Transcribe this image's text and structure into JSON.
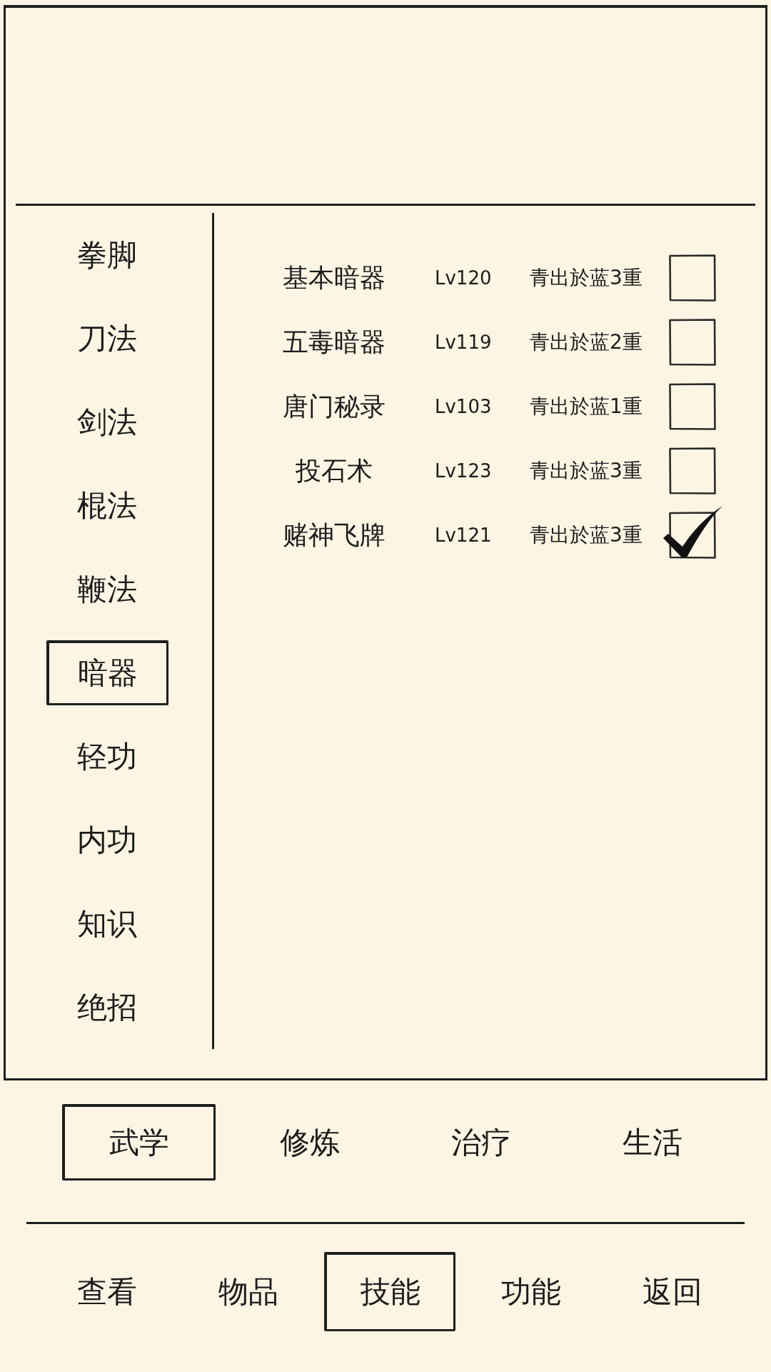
{
  "categories": [
    {
      "label": "拳脚",
      "selected": false
    },
    {
      "label": "刀法",
      "selected": false
    },
    {
      "label": "剑法",
      "selected": false
    },
    {
      "label": "棍法",
      "selected": false
    },
    {
      "label": "鞭法",
      "selected": false
    },
    {
      "label": "暗器",
      "selected": true
    },
    {
      "label": "轻功",
      "selected": false
    },
    {
      "label": "内功",
      "selected": false
    },
    {
      "label": "知识",
      "selected": false
    },
    {
      "label": "绝招",
      "selected": false
    }
  ],
  "skills": [
    {
      "name": "基本暗器",
      "level_label": "Lv120",
      "realm": "青出於蓝3重",
      "checked": false
    },
    {
      "name": "五毒暗器",
      "level_label": "Lv119",
      "realm": "青出於蓝2重",
      "checked": false
    },
    {
      "name": "唐门秘录",
      "level_label": "Lv103",
      "realm": "青出於蓝1重",
      "checked": false
    },
    {
      "name": "投石术",
      "level_label": "Lv123",
      "realm": "青出於蓝3重",
      "checked": false
    },
    {
      "name": "赌神飞牌",
      "level_label": "Lv121",
      "realm": "青出於蓝3重",
      "checked": true
    }
  ],
  "skill_types": [
    {
      "label": "武学",
      "selected": true
    },
    {
      "label": "修炼",
      "selected": false
    },
    {
      "label": "治疗",
      "selected": false
    },
    {
      "label": "生活",
      "selected": false
    }
  ],
  "menu": [
    {
      "label": "查看",
      "selected": false
    },
    {
      "label": "物品",
      "selected": false
    },
    {
      "label": "技能",
      "selected": true
    },
    {
      "label": "功能",
      "selected": false
    },
    {
      "label": "返回",
      "selected": false
    }
  ]
}
